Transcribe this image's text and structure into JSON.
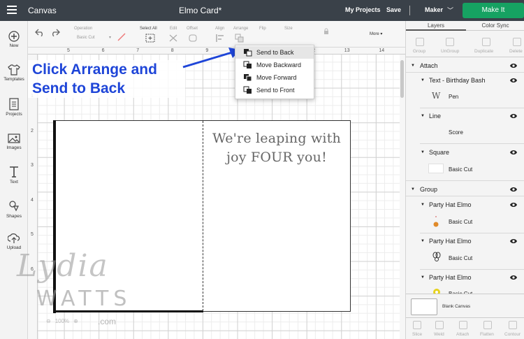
{
  "topbar": {
    "app_title": "Canvas",
    "doc_title": "Elmo Card*",
    "my_projects": "My Projects",
    "save": "Save",
    "machine": "Maker",
    "make_it": "Make It"
  },
  "sidebar": {
    "items": [
      {
        "label": "New",
        "icon": "plus-icon"
      },
      {
        "label": "Templates",
        "icon": "shirt-icon"
      },
      {
        "label": "Projects",
        "icon": "projects-icon"
      },
      {
        "label": "Images",
        "icon": "image-icon"
      },
      {
        "label": "Text",
        "icon": "text-icon"
      },
      {
        "label": "Shapes",
        "icon": "shapes-icon"
      },
      {
        "label": "Upload",
        "icon": "upload-icon"
      }
    ]
  },
  "toolbar": {
    "operation_label": "Operation",
    "operation_value": "Basic Cut",
    "select_all": "Select All",
    "edit": "Edit",
    "offset": "Offset",
    "align": "Align",
    "arrange": "Arrange",
    "flip": "Flip",
    "size": "Size",
    "more": "More"
  },
  "ruler": {
    "horizontal": [
      "5",
      "6",
      "7",
      "8",
      "9",
      "10",
      "11",
      "12",
      "13",
      "14"
    ],
    "vertical": [
      "1",
      "2",
      "3",
      "4",
      "5",
      "6"
    ]
  },
  "arrange_menu": {
    "items": [
      {
        "label": "Send to Back",
        "selected": true
      },
      {
        "label": "Move Backward",
        "selected": false
      },
      {
        "label": "Move Forward",
        "selected": false
      },
      {
        "label": "Send to Front",
        "selected": false
      }
    ]
  },
  "callout": {
    "line1": "Click Arrange and",
    "line2": "Send to Back",
    "color": "#1e45d8"
  },
  "card": {
    "line1": "We're leaping with",
    "line2": "joy FOUR you!"
  },
  "watermark": {
    "name1": "Lydia",
    "name2": "WATTS",
    "domain": ".com",
    "zoom": "100%"
  },
  "panel": {
    "tab_layers": "Layers",
    "tab_color_sync": "Color Sync",
    "actions": [
      "Group",
      "UnGroup",
      "Duplicate",
      "Delete"
    ],
    "layers": {
      "attach": "Attach",
      "text_layer": "Text - Birthday Bash",
      "pen": "Pen",
      "line": "Line",
      "score": "Score",
      "square": "Square",
      "basic_cut": "Basic Cut",
      "group": "Group",
      "elmo": "Party Hat Elmo"
    },
    "blank_canvas": "Blank Canvas",
    "bottom_actions": [
      "Slice",
      "Weld",
      "Attach",
      "Flatten",
      "Contour"
    ]
  },
  "colors": {
    "topbar": "#3a4149",
    "make_it": "#16a262",
    "callout": "#1e45d8"
  }
}
